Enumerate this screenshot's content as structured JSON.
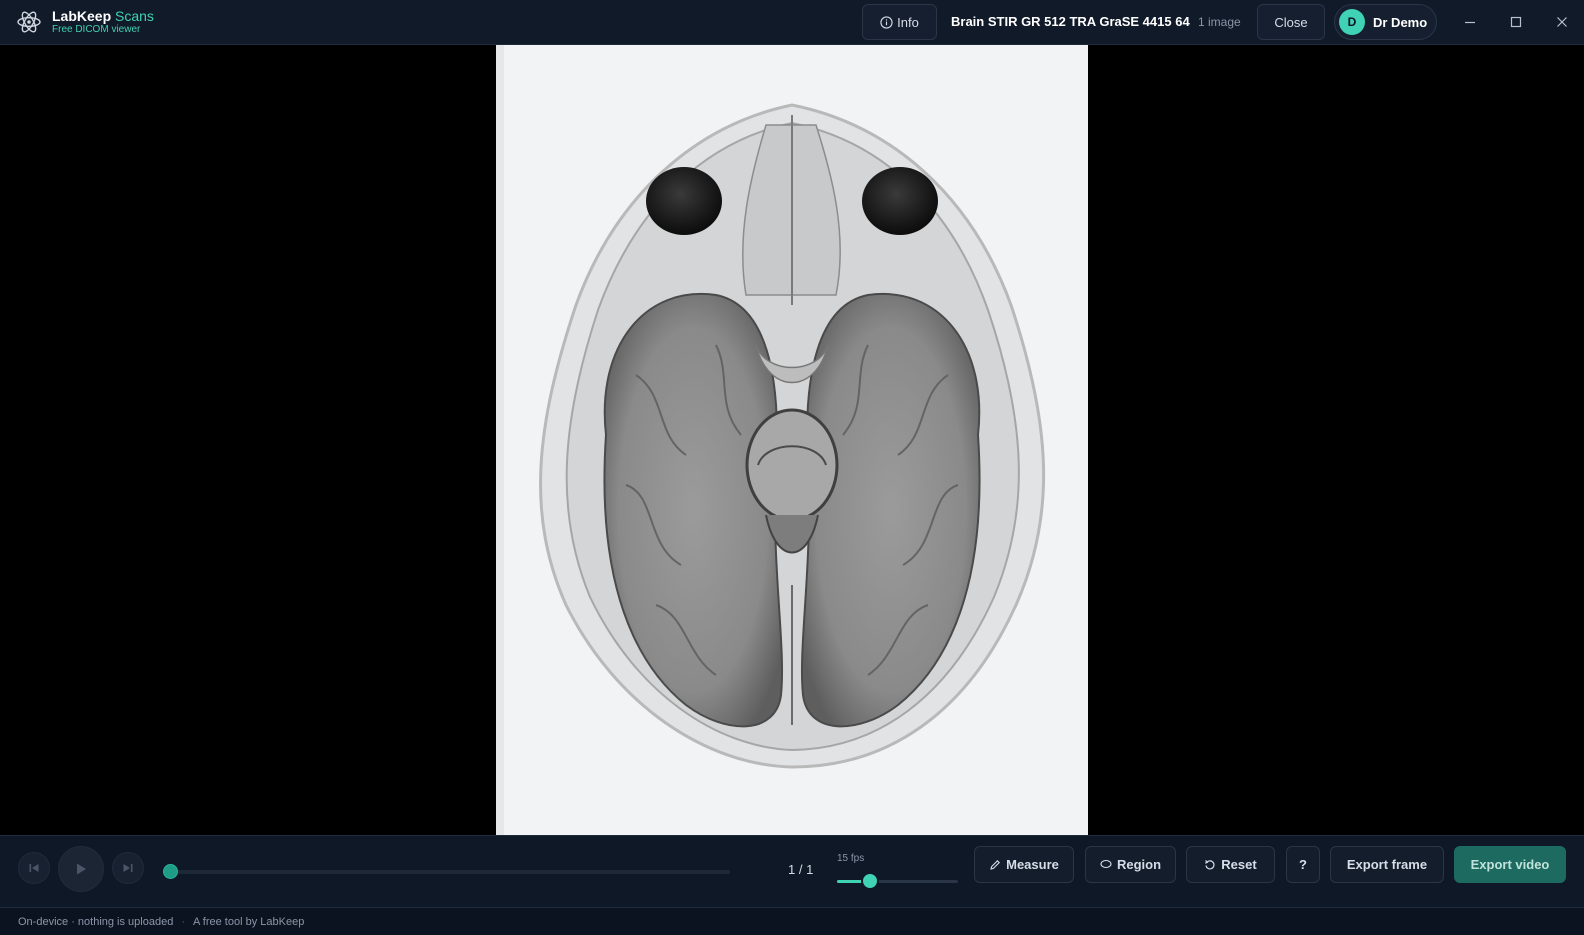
{
  "app": {
    "brand_name": "LabKeep",
    "brand_accent": "Scans",
    "subtitle": "Free DICOM viewer",
    "accent_color": "#3fd2b4"
  },
  "header": {
    "info_label": "Info",
    "series_title": "Brain STIR GR 512 TRA GraSE 4415 64",
    "series_count": "1 image",
    "close_label": "Close",
    "user": {
      "initial": "D",
      "name": "Dr Demo"
    },
    "window_controls": [
      "minimize-icon",
      "maximize-icon",
      "close-icon"
    ]
  },
  "player": {
    "frame_counter": "1 / 1",
    "fps_label": "15 fps",
    "fps_level": 0.27,
    "timeline_progress": 0.0
  },
  "tools": {
    "measure_label": "Measure",
    "region_label": "Region",
    "reset_label": "Reset",
    "help_label": "?",
    "export_frame_label": "Export frame",
    "export_video_label": "Export video"
  },
  "footer": {
    "privacy_text": "On-device · nothing is uploaded",
    "separator": "·",
    "credit_text": "A free tool by LabKeep"
  }
}
